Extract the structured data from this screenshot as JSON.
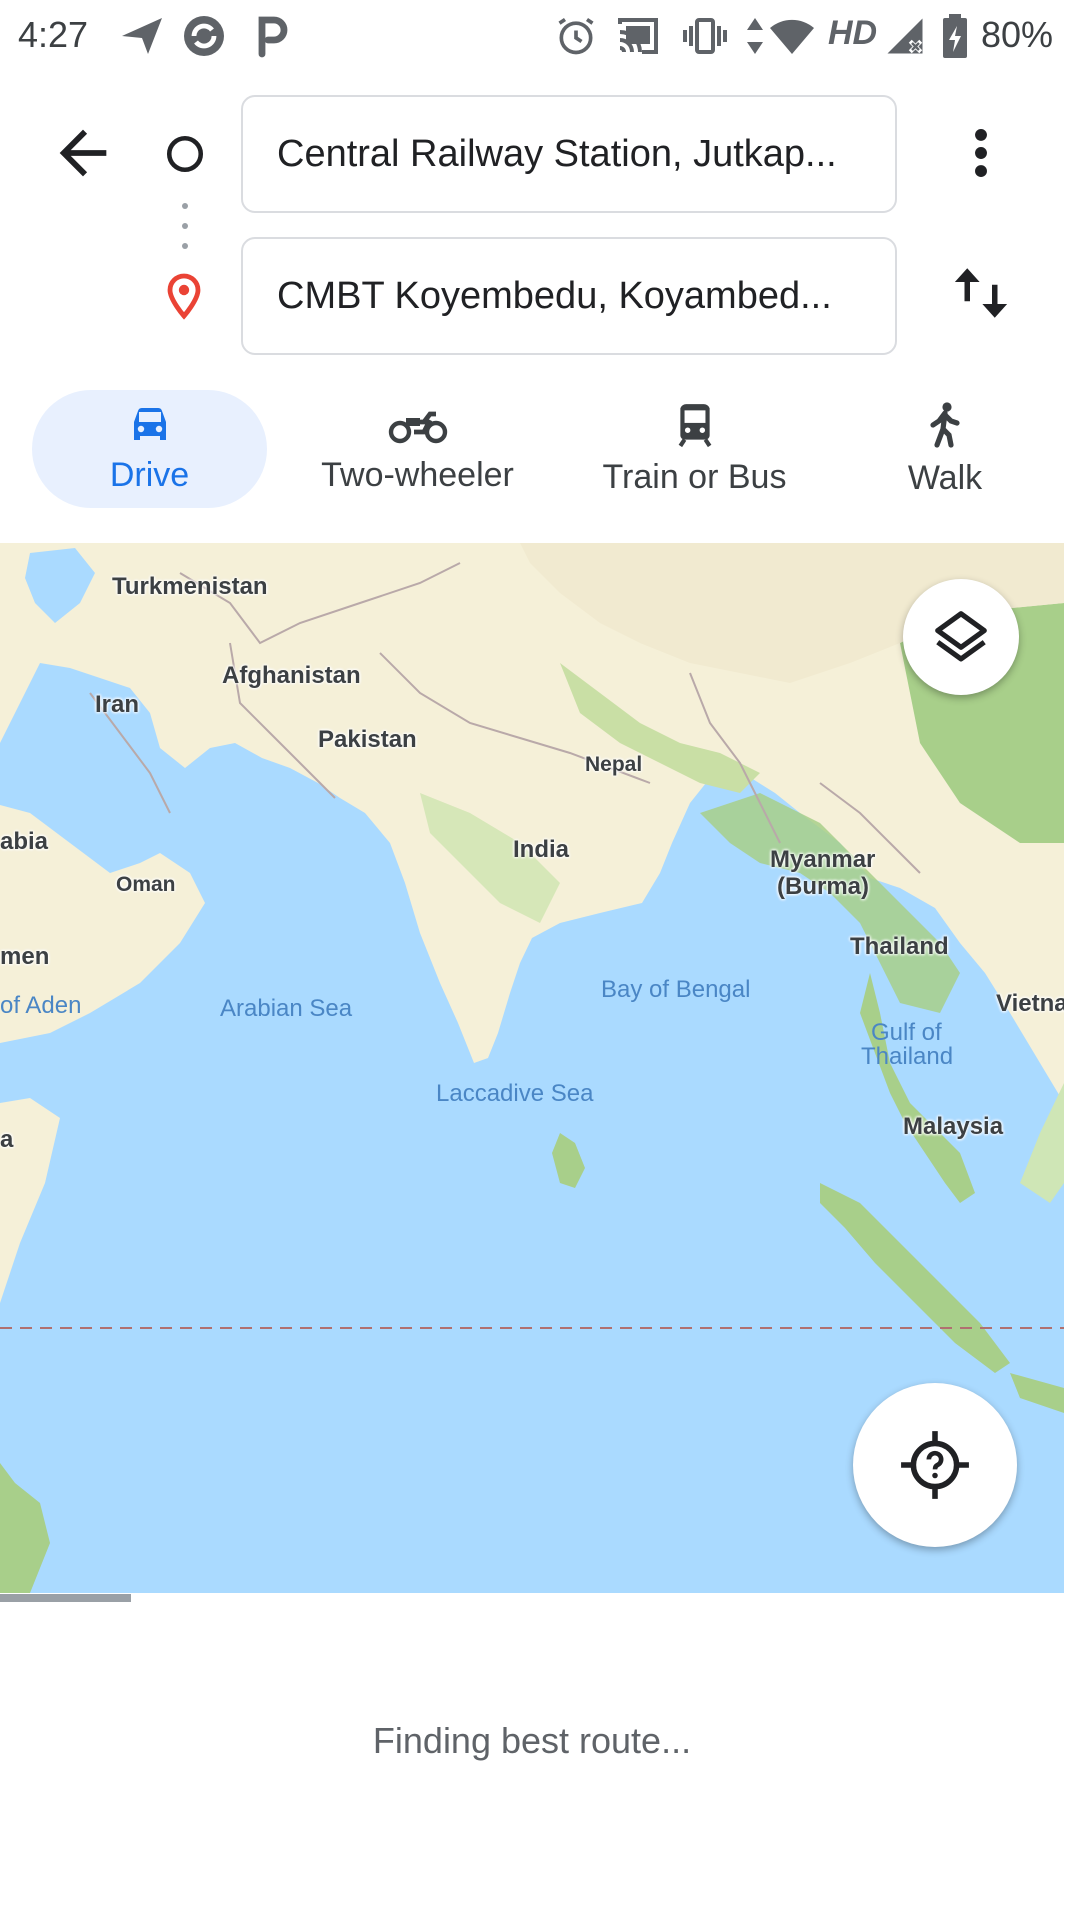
{
  "status_bar": {
    "time": "4:27",
    "network_label": "HD",
    "battery": "80%",
    "icons": [
      "send-icon",
      "sync-icon",
      "parking-icon",
      "alarm-icon",
      "cast-icon",
      "vibrate-icon",
      "data-arrows-icon",
      "wifi-icon",
      "signal-icon",
      "battery-icon"
    ]
  },
  "header": {
    "back_icon": "arrow-back-icon",
    "origin": "Central Railway Station, Jutkap...",
    "destination": "CMBT Koyembedu, Koyambed...",
    "more_icon": "more-vert-icon",
    "swap_icon": "swap-vertical-icon"
  },
  "modes": [
    {
      "label": "Drive",
      "icon": "car-icon",
      "active": true
    },
    {
      "label": "Two-wheeler",
      "icon": "motorcycle-icon",
      "active": false
    },
    {
      "label": "Train or Bus",
      "icon": "train-icon",
      "active": false
    },
    {
      "label": "Walk",
      "icon": "walk-icon",
      "active": false
    }
  ],
  "map": {
    "countries": [
      "Turkmenistan",
      "Afghanistan",
      "Iran",
      "Pakistan",
      "Nepal",
      "India",
      "Myanmar",
      "(Burma)",
      "Thailand",
      "Vietna",
      "Malaysia",
      "Oman",
      "abia",
      "men"
    ],
    "seas": [
      "Arabian Sea",
      "Bay of Bengal",
      "Laccadive Sea",
      "Gulf of",
      "Thailand",
      "of Aden"
    ],
    "partial_label": "a",
    "layers_icon": "layers-icon",
    "location_icon": "location-unknown-icon"
  },
  "colors": {
    "accent": "#1a73e8",
    "accent_bg": "#e8f0fe",
    "water": "#aadaff",
    "land": "#f5f0d8",
    "vegetation": "#a8cf8a",
    "pin": "#ea4335"
  },
  "loading": {
    "message": "Finding best route..."
  }
}
